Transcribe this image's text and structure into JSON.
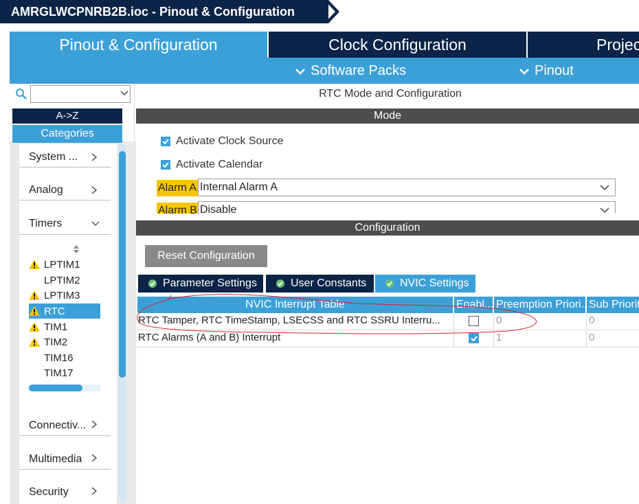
{
  "window": {
    "title": "AMRGLWCPNRB2B.ioc - Pinout & Configuration"
  },
  "main_tabs": [
    {
      "label": "Pinout & Configuration",
      "active": true
    },
    {
      "label": "Clock Configuration",
      "active": false
    },
    {
      "label": "Project"
    }
  ],
  "sub_toolbar": {
    "software_packs": "Software Packs",
    "pinout": "Pinout"
  },
  "sidebar": {
    "search_value": "",
    "az_label": "A->Z",
    "categories_label": "Categories",
    "categories": [
      {
        "label": "System ..."
      },
      {
        "label": "Analog"
      },
      {
        "label": "Timers",
        "expanded": true
      },
      {
        "label": "Connectiv..."
      },
      {
        "label": "Multimedia"
      },
      {
        "label": "Security"
      }
    ],
    "peripherals": [
      {
        "label": "LPTIM1",
        "warning": true
      },
      {
        "label": "LPTIM2",
        "warning": false
      },
      {
        "label": "LPTIM3",
        "warning": true
      },
      {
        "label": "RTC",
        "warning": true,
        "selected": true
      },
      {
        "label": "TIM1",
        "warning": true
      },
      {
        "label": "TIM2",
        "warning": true
      },
      {
        "label": "TIM16",
        "warning": false
      },
      {
        "label": "TIM17",
        "warning": false
      }
    ]
  },
  "panel": {
    "header": "RTC Mode and Configuration",
    "mode_label": "Mode",
    "activate_clock_source": {
      "label": "Activate Clock Source",
      "checked": true
    },
    "activate_calendar": {
      "label": "Activate Calendar",
      "checked": true
    },
    "alarm_a": {
      "label": "Alarm A",
      "value": "Internal Alarm A"
    },
    "alarm_b": {
      "label": "Alarm B",
      "value": "Disable"
    },
    "configuration_label": "Configuration",
    "reset_button": "Reset Configuration",
    "tabs": [
      {
        "label": "Parameter Settings"
      },
      {
        "label": "User Constants"
      },
      {
        "label": "NVIC Settings",
        "active": true
      }
    ],
    "table": {
      "headers": [
        "NVIC Interrupt Table",
        "Enabl...",
        "Preemption Priori...",
        "Sub Priorit"
      ],
      "rows": [
        {
          "name": "RTC Tamper, RTC TimeStamp, LSECSS and RTC SSRU Interru...",
          "enabled": false,
          "preemption": "0",
          "sub": "0"
        },
        {
          "name": "RTC Alarms (A and B) Interrupt",
          "enabled": true,
          "preemption": "1",
          "sub": "0"
        }
      ]
    }
  },
  "colors": {
    "navy": "#0b2447",
    "accent_blue": "#3ca0d8",
    "section_gray": "#4d4d4d",
    "warning_yellow": "#f7c600",
    "annotation_red": "#d8202a"
  }
}
